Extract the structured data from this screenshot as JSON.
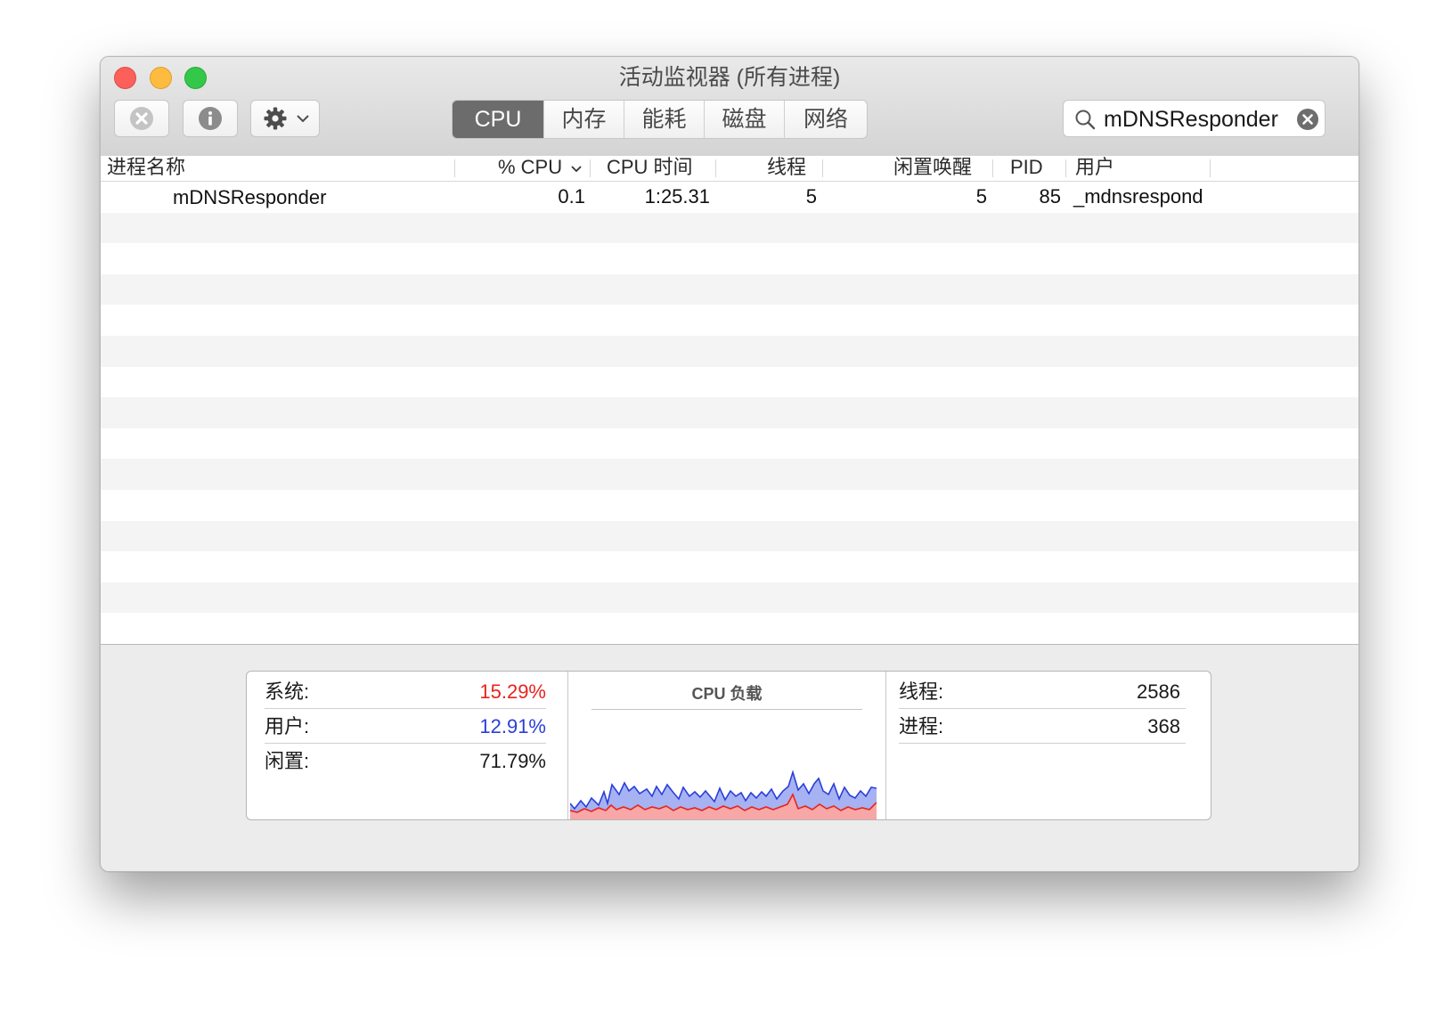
{
  "window": {
    "title": "活动监视器 (所有进程)"
  },
  "toolbar": {
    "stop_icon": "stop-process-icon",
    "info_icon": "info-icon",
    "gear_icon": "gear-icon",
    "tabs": [
      {
        "label": "CPU",
        "active": true
      },
      {
        "label": "内存",
        "active": false
      },
      {
        "label": "能耗",
        "active": false
      },
      {
        "label": "磁盘",
        "active": false
      },
      {
        "label": "网络",
        "active": false
      }
    ],
    "search_value": "mDNSResponder"
  },
  "table": {
    "headers": {
      "name": "进程名称",
      "cpu": "% CPU",
      "cpu_time": "CPU 时间",
      "threads": "线程",
      "idle_wakeups": "闲置唤醒",
      "pid": "PID",
      "user": "用户"
    },
    "rows": [
      {
        "name": "mDNSResponder",
        "cpu": "0.1",
        "cpu_time": "1:25.31",
        "threads": "5",
        "idle_wakeups": "5",
        "pid": "85",
        "user": "_mdnsrespond"
      }
    ]
  },
  "summary": {
    "system_label": "系统:",
    "system_value": "15.29%",
    "user_label": "用户:",
    "user_value": "12.91%",
    "idle_label": "闲置:",
    "idle_value": "71.79%",
    "chart_title": "CPU 负载",
    "threads_label": "线程:",
    "threads_value": "2586",
    "processes_label": "进程:",
    "processes_value": "368",
    "colors": {
      "system": "#e8231f",
      "user": "#2a3fd8"
    }
  }
}
